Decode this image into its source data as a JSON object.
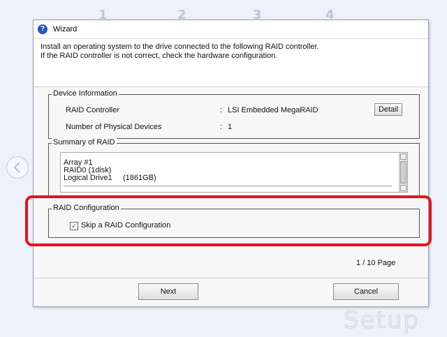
{
  "background": {
    "steps": [
      "1",
      "2",
      "3",
      "4"
    ],
    "back_icon": "circle-back-arrow-icon",
    "logo_text": "Setup"
  },
  "dialog": {
    "title": "Wizard",
    "title_icon": "help-question-icon",
    "intro_line1": "Install an operating system to the drive connected to the following RAID controller.",
    "intro_line2": "If the RAID controller is not correct, check the hardware configuration.",
    "device_info": {
      "label": "Device Information",
      "raid_controller_label": "RAID Controller",
      "raid_controller_sep": ":",
      "raid_controller_value": "LSI Embedded MegaRAID",
      "physical_devices_label": "Number of Physical Devices",
      "physical_devices_sep": ":",
      "physical_devices_value": "1",
      "detail_button": "Detail"
    },
    "summary": {
      "label": "Summary of RAID",
      "lines": [
        "Array #1",
        "RAID0 (1disk)",
        "Logical Drive1     (1861GB)"
      ]
    },
    "raid_config": {
      "label": "RAID Configuration",
      "skip_label": "Skip a RAID Configuration",
      "skip_checked": true
    },
    "page_indicator": "1 / 10 Page",
    "next_button": "Next",
    "cancel_button": "Cancel"
  },
  "colors": {
    "highlight": "#e8101d",
    "title_icon": "#2a52be"
  }
}
